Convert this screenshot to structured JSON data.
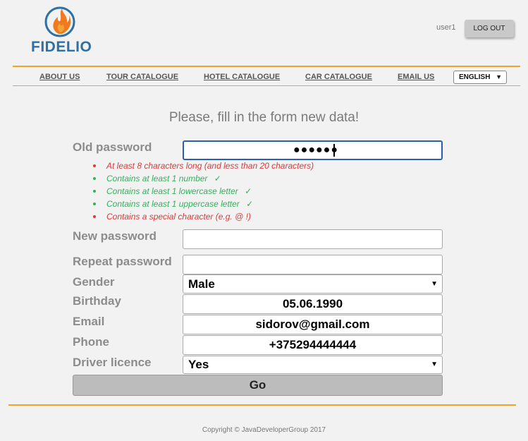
{
  "header": {
    "logo_text": "FIDELIO",
    "username": "user1",
    "logout_label": "LOG OUT"
  },
  "nav": {
    "items": [
      {
        "label": "ABOUT US"
      },
      {
        "label": "TOUR CATALOGUE"
      },
      {
        "label": "HOTEL CATALOGUE"
      },
      {
        "label": "CAR CATALOGUE"
      },
      {
        "label": "EMAIL US"
      }
    ],
    "language": "ENGLISH"
  },
  "form": {
    "title": "Please, fill in the form new data!",
    "old_password": {
      "label": "Old password",
      "value": "●●●●●●"
    },
    "password_rules": [
      {
        "text": "At least 8 characters long (and less than 20 characters)",
        "status": "fail"
      },
      {
        "text": "Contains at least 1 number",
        "status": "ok"
      },
      {
        "text": "Contains at least 1 lowercase letter",
        "status": "ok"
      },
      {
        "text": "Contains at least 1 uppercase letter",
        "status": "ok"
      },
      {
        "text": "Contains a special character (e.g. @ !)",
        "status": "fail"
      }
    ],
    "check_glyph": "✓",
    "new_password": {
      "label": "New password",
      "value": ""
    },
    "repeat_password": {
      "label": "Repeat password",
      "value": ""
    },
    "gender": {
      "label": "Gender",
      "value": "Male"
    },
    "birthday": {
      "label": "Birthday",
      "value": "05.06.1990"
    },
    "email": {
      "label": "Email",
      "value": "sidorov@gmail.com"
    },
    "phone": {
      "label": "Phone",
      "value": "+375294444444"
    },
    "driver_licence": {
      "label": "Driver licence",
      "value": "Yes"
    },
    "submit_label": "Go"
  },
  "footer": {
    "copyright": "Copyright © JavaDeveloperGroup 2017"
  },
  "colors": {
    "accent": "#f0a524",
    "logo_blue": "#2d6fa6",
    "rule_fail": "#d93a3a",
    "rule_ok": "#2fb35a",
    "focus_border": "#2a5eb0"
  }
}
